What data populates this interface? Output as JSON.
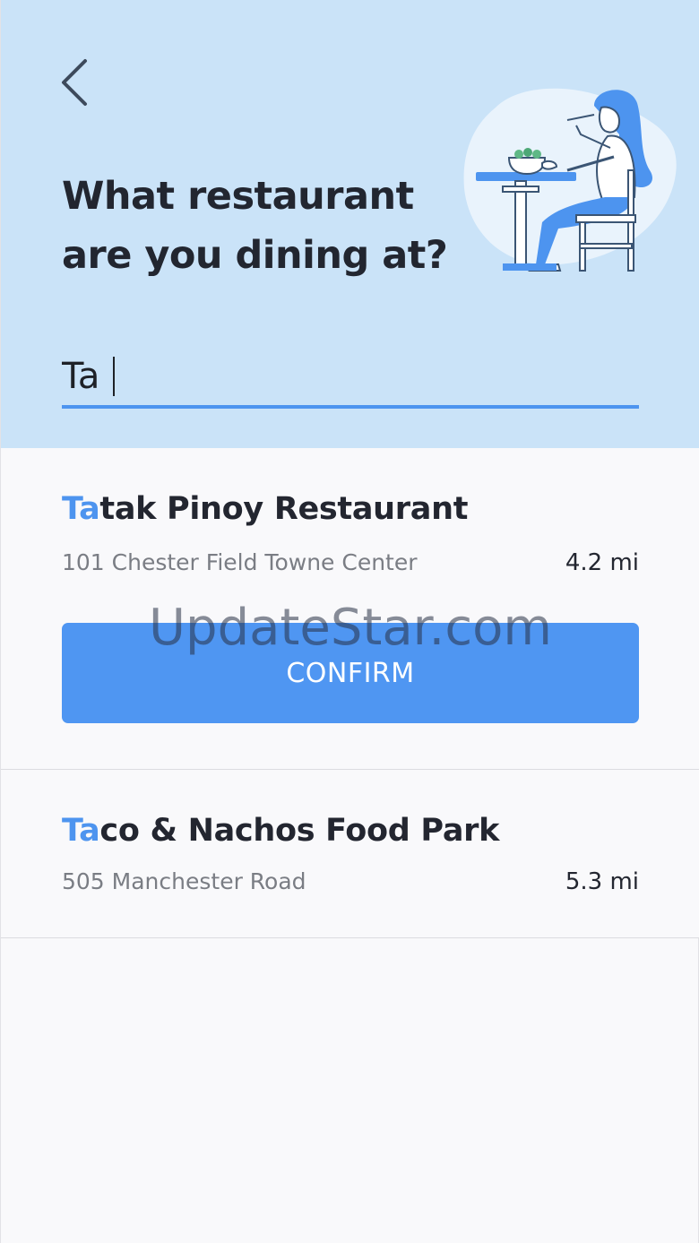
{
  "header": {
    "back_icon": "chevron-left-icon",
    "title_line1": "What restaurant",
    "title_line2": "are you dining at?",
    "illustration": "woman-eating-at-table-illustration"
  },
  "search": {
    "value": "Ta",
    "placeholder": ""
  },
  "results": [
    {
      "name_match": "Ta",
      "name_rest": "tak Pinoy Restaurant",
      "address": "101 Chester Field Towne Center",
      "distance": "4.2 mi",
      "confirm_label": "CONFIRM"
    },
    {
      "name_match": "Ta",
      "name_rest": "co & Nachos Food Park",
      "address": "505 Manchester Road",
      "distance": "5.3 mi"
    }
  ],
  "watermark": "UpdateStar.com",
  "colors": {
    "header_bg": "#cae3f8",
    "accent": "#4d94ef",
    "button": "#4f96f2",
    "title_text": "#222630",
    "secondary_text": "#7a7d84"
  }
}
